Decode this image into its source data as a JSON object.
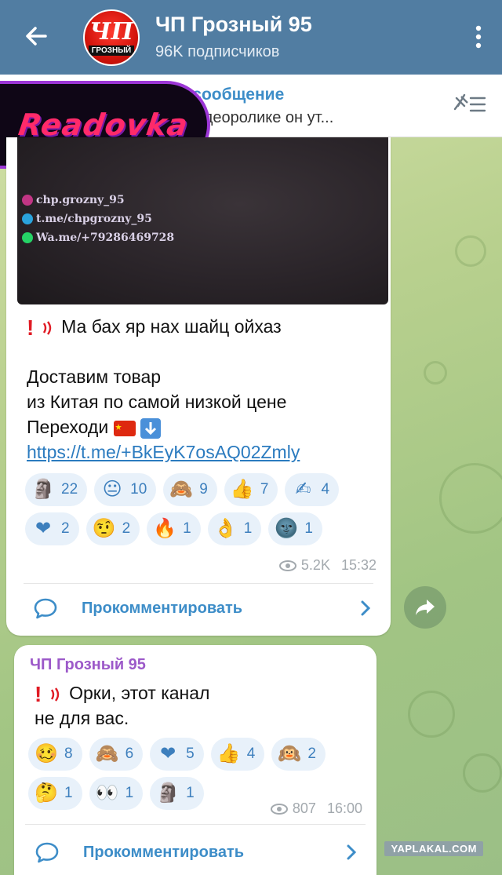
{
  "header": {
    "title": "ЧП Грозный 95",
    "subtitle": "96K подписчиков",
    "avatar_big": "ЧП",
    "avatar_small": "ГРОЗНЫЙ"
  },
  "pinned": {
    "title": "Закреплённое сообщение",
    "text": "В предыдущем видеоролике он ут..."
  },
  "logo": {
    "text": "Readovka"
  },
  "messages": [
    {
      "watermarks": [
        "chp.grozny_95",
        "t.me/chpgrozny_95",
        "Wa.me/+79286469728"
      ],
      "line1": "Ма бах яр нах шайц ойхаз",
      "line2": "Доставим товар",
      "line3": "из Китая по самой низкой цене",
      "line4": "Переходи",
      "link": "https://t.me/+BkEyK7osAQ02Zmly",
      "reactions": [
        {
          "emoji": "🗿",
          "count": "22"
        },
        {
          "emoji": "😐",
          "count": "10"
        },
        {
          "emoji": "🙈",
          "count": "9"
        },
        {
          "emoji": "👍",
          "count": "7"
        },
        {
          "emoji": "✍",
          "count": "4"
        },
        {
          "emoji": "❤",
          "count": "2"
        },
        {
          "emoji": "🤨",
          "count": "2"
        },
        {
          "emoji": "🔥",
          "count": "1"
        },
        {
          "emoji": "👌",
          "count": "1"
        },
        {
          "emoji": "🌚",
          "count": "1"
        }
      ],
      "views": "5.2K",
      "time": "15:32",
      "comment_label": "Прокомментировать"
    },
    {
      "sender": "ЧП Грозный 95",
      "line1": "Орки, этот канал",
      "line2": "не для вас.",
      "reactions": [
        {
          "emoji": "🥴",
          "count": "8"
        },
        {
          "emoji": "🙈",
          "count": "6"
        },
        {
          "emoji": "❤",
          "count": "5"
        },
        {
          "emoji": "👍",
          "count": "4"
        },
        {
          "emoji": "🙉",
          "count": "2"
        },
        {
          "emoji": "🤔",
          "count": "1"
        },
        {
          "emoji": "👀",
          "count": "1"
        },
        {
          "emoji": "🗿",
          "count": "1"
        }
      ],
      "views": "807",
      "time": "16:00",
      "comment_label": "Прокомментировать"
    }
  ],
  "site_watermark": "YAPLAKAL.COM",
  "colors": {
    "header": "#517da2",
    "accent": "#3d8dc8",
    "reaction_bg": "#e8f1fa",
    "sender": "#9c59c9"
  }
}
